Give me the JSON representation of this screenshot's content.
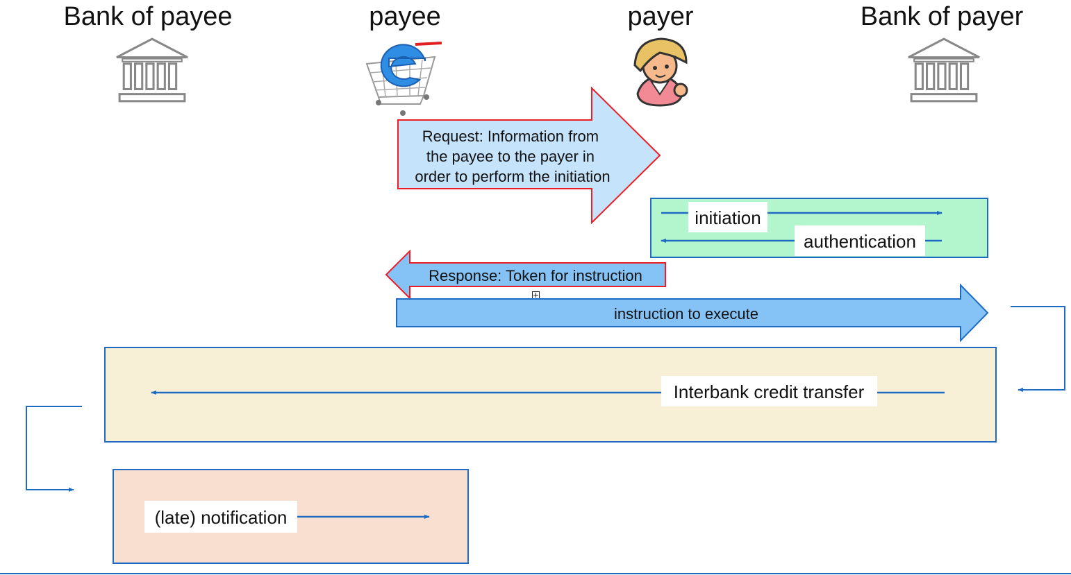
{
  "actors": [
    {
      "label": "Bank of payee",
      "icon": "bank-icon"
    },
    {
      "label": "payee",
      "icon": "shopping-cart-icon"
    },
    {
      "label": "payer",
      "icon": "person-icon"
    },
    {
      "label": "Bank of payer",
      "icon": "bank-icon"
    }
  ],
  "request": {
    "lines": [
      "Request: Information from",
      "the payee to the payer in",
      "order to perform the initiation"
    ]
  },
  "initiation_label": "initiation",
  "authentication_label": "authentication",
  "response_label": "Response: Token for instruction",
  "instruction_label": "instruction to execute",
  "interbank_label": "Interbank credit transfer",
  "notification_label": "(late) notification",
  "colors": {
    "request_fill": "#c5e3fb",
    "red_outline": "#ee1c25",
    "blue_outline": "#1e6bc4",
    "blue_arrow_fill": "#85c3f7",
    "green_box": "#b3f5cc",
    "beige_box": "#f7efd6",
    "peach_box": "#f9dfcf"
  }
}
